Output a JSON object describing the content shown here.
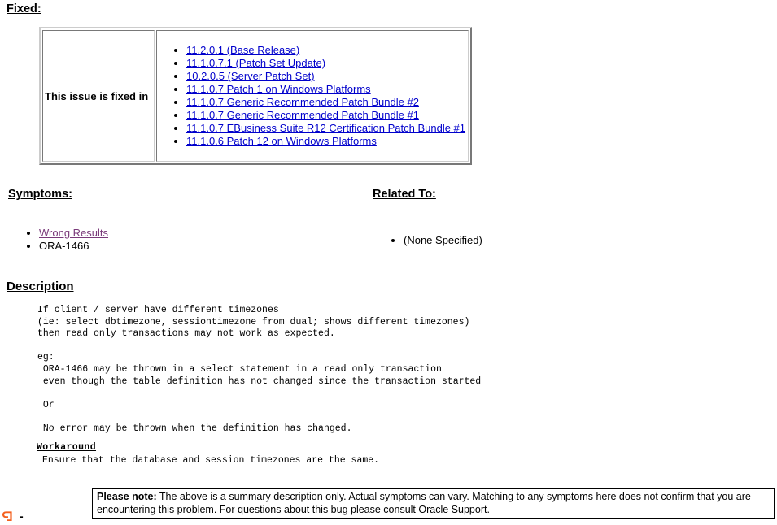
{
  "page": {
    "background_color": "#ffffff",
    "link_color": "#0000cc",
    "visited_link_color": "#7a3a7a",
    "text_color": "#000000",
    "accent_icon_color": "#f4601e"
  },
  "fixed": {
    "heading": "Fixed:",
    "label": "This issue is fixed in",
    "items": [
      "11.2.0.1 (Base Release)",
      "11.1.0.7.1 (Patch Set Update)",
      "10.2.0.5 (Server Patch Set)",
      "11.1.0.7 Patch 1 on Windows Platforms",
      "11.1.0.7 Generic Recommended Patch Bundle #2",
      "11.1.0.7 Generic Recommended Patch Bundle #1",
      "11.1.0.7 EBusiness Suite R12 Certification Patch Bundle #1",
      "11.1.0.6 Patch 12 on Windows Platforms"
    ]
  },
  "symptoms": {
    "heading": "Symptoms:",
    "items": [
      {
        "text": "Wrong Results",
        "is_link": true
      },
      {
        "text": "ORA-1466",
        "is_link": false
      }
    ]
  },
  "related": {
    "heading": "Related To:",
    "items": [
      {
        "text": "(None Specified)",
        "is_link": false
      }
    ]
  },
  "description": {
    "heading": "Description",
    "body": "If client / server have different timezones\n(ie: select dbtimezone, sessiontimezone from dual; shows different timezones)\nthen read only transactions may not work as expected.\n\neg:\n ORA-1466 may be thrown in a select statement in a read only transaction\n even though the table definition has not changed since the transaction started\n\n Or\n\n No error may be thrown when the definition has changed.",
    "workaround_heading": "Workaround",
    "workaround_body": "Ensure that the database and session timezones are the same."
  },
  "please_note": {
    "label": "Please note:",
    "text": " The above is a summary description only. Actual symptoms can vary. Matching to any symptoms here does not confirm that you are encountering this problem. For questions about this bug please consult Oracle Support."
  },
  "bottom_marker": {
    "icon": "oracle-logo-icon",
    "dash": "-"
  }
}
